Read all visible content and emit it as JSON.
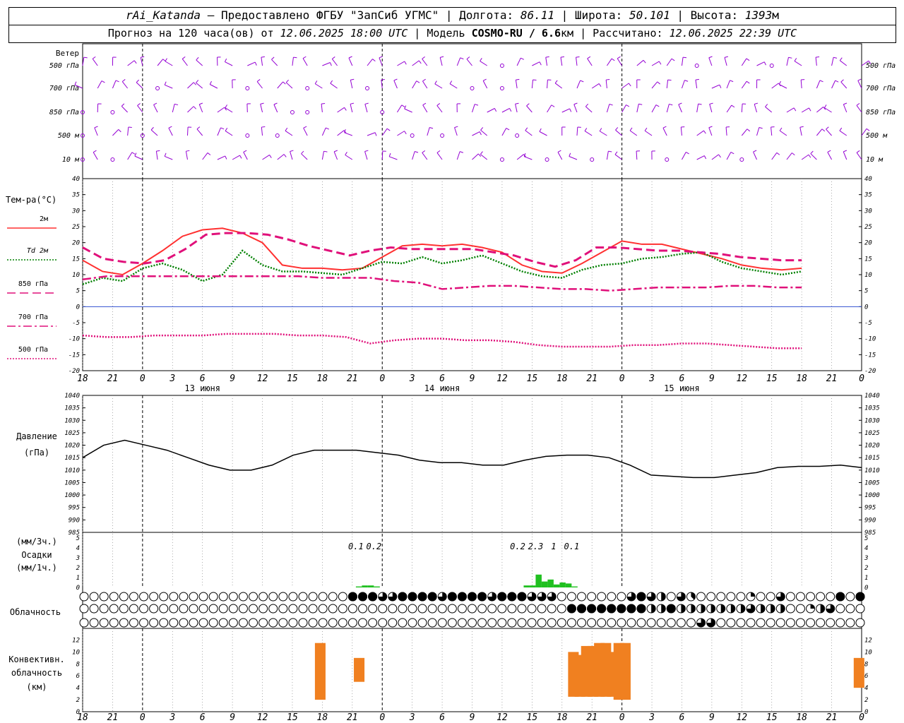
{
  "header": {
    "station": "rAi_Katanda",
    "sep1": " — ",
    "provider": "Предоставлено ФГБУ \"ЗапСиб УГМС\"",
    "lon_label": " | Долгота: ",
    "lon": "86.11",
    "lat_label": " | Широта: ",
    "lat": "50.101",
    "alt_label": " | Высота: ",
    "alt": "1393",
    "alt_unit": "м",
    "forecast_prefix": "Прогноз на 120 часа(ов) от ",
    "forecast_start": "12.06.2025 18:00 UTC",
    "model_label": "  | Модель ",
    "model": "COSMO-RU / 6.6",
    "model_unit": "км",
    "calc_label": " | Рассчитано: ",
    "calc_time": "12.06.2025 22:39 UTC"
  },
  "chart_data": {
    "type": "meteogram",
    "x_hours_ticks": [
      "18",
      "21",
      "0",
      "3",
      "6",
      "9",
      "12",
      "15",
      "18",
      "21",
      "0",
      "3",
      "6",
      "9",
      "12",
      "15",
      "18",
      "21",
      "0",
      "3",
      "6",
      "9",
      "12",
      "15",
      "18",
      "21",
      "0"
    ],
    "day_labels": [
      "13 июня",
      "14 июня",
      "15 июня"
    ],
    "wind": {
      "title": "Ветер",
      "levels": [
        "500 гПа",
        "700 гПа",
        "850 гПа",
        "500 м",
        "10 м"
      ],
      "color": "#9400d3"
    },
    "temperature": {
      "title": "Тем-ра(°C)",
      "ylim": [
        -20,
        40
      ],
      "yticks": [
        "40",
        "35",
        "30",
        "25",
        "20",
        "15",
        "10",
        "5",
        "0",
        "-5",
        "-10",
        "-15",
        "-20"
      ],
      "legend": [
        {
          "label": "2м",
          "color": "#ff3030",
          "style": "solid"
        },
        {
          "label": "Td  2м",
          "color": "#008000",
          "style": "dotted"
        },
        {
          "label": "850 гПа",
          "color": "#e0107a",
          "style": "dash"
        },
        {
          "label": "700 гПа",
          "color": "#e0107a",
          "style": "dashdot"
        },
        {
          "label": "500 гПа",
          "color": "#e0107a",
          "style": "dotted"
        }
      ],
      "series": [
        {
          "name": "2м",
          "x": [
            0,
            3,
            6,
            9,
            12,
            15,
            18,
            21,
            24,
            27,
            30,
            33,
            36,
            39,
            42,
            45,
            48,
            51,
            54,
            57,
            60,
            63,
            66,
            69,
            72,
            75,
            78,
            81,
            84,
            87,
            90,
            93,
            96,
            99,
            102,
            105,
            108,
            111,
            114,
            117,
            120
          ],
          "values": [
            14.5,
            11,
            10,
            13.5,
            17.5,
            22,
            24,
            24.5,
            23,
            20,
            13,
            12,
            12,
            11.5,
            12,
            15.5,
            19,
            19.5,
            19,
            19.5,
            18.5,
            17,
            13,
            11,
            10.5,
            13.5,
            17,
            20.5,
            19.5,
            19.5,
            18,
            16.5,
            15,
            13,
            12,
            11.5,
            12
          ]
        },
        {
          "name": "Td  2м",
          "x": [
            0,
            3,
            6,
            9,
            12,
            15,
            18,
            21,
            24,
            27,
            30,
            33,
            36,
            39,
            42,
            45,
            48,
            51,
            54,
            57,
            60,
            63,
            66,
            69,
            72,
            75,
            78,
            81,
            84,
            87,
            90,
            93,
            96,
            99,
            102,
            105,
            108,
            111,
            114,
            117,
            120
          ],
          "values": [
            7,
            9,
            8,
            12,
            13.5,
            11.5,
            8,
            10,
            17.5,
            13,
            11,
            11,
            10.5,
            10,
            12,
            14,
            13.5,
            15.5,
            13.5,
            14.5,
            16,
            13.5,
            11,
            9.5,
            9,
            11.5,
            13,
            13.5,
            15,
            15.5,
            16.5,
            17,
            14,
            12,
            11,
            10,
            11
          ]
        },
        {
          "name": "850 гПа",
          "x": [
            0,
            3,
            6,
            9,
            12,
            15,
            18,
            21,
            24,
            27,
            30,
            33,
            36,
            39,
            42,
            45,
            48,
            51,
            54,
            57,
            60,
            63,
            66,
            69,
            72,
            75,
            78,
            81,
            84,
            87,
            90,
            93,
            96,
            99,
            102,
            105,
            108,
            111,
            114,
            117,
            120
          ],
          "values": [
            18.5,
            15,
            14,
            13.5,
            14.5,
            18,
            22.5,
            23,
            23,
            22.5,
            21,
            19,
            17.5,
            16,
            17.5,
            18.5,
            18,
            18,
            18,
            18,
            17,
            16,
            14,
            12.5,
            14.5,
            18.5,
            18.5,
            18,
            17.5,
            17.5,
            17,
            16.5,
            15.5,
            15,
            14.5,
            14.5
          ]
        },
        {
          "name": "700 гПа",
          "x": [
            0,
            3,
            6,
            9,
            12,
            15,
            18,
            21,
            24,
            27,
            30,
            33,
            36,
            39,
            42,
            45,
            48,
            51,
            54,
            57,
            60,
            63,
            66,
            69,
            72,
            75,
            78,
            81,
            84,
            87,
            90,
            93,
            96,
            99,
            102,
            105,
            108,
            111,
            114,
            117,
            120
          ],
          "values": [
            8.5,
            9.5,
            9.5,
            9.5,
            9.5,
            9.5,
            9.5,
            9.5,
            9.5,
            9.5,
            9,
            9,
            9,
            8,
            7.5,
            5.5,
            6,
            6.5,
            6.5,
            6,
            5.5,
            5.5,
            5,
            5.5,
            6,
            6,
            6,
            6.5,
            6.5,
            6,
            6
          ]
        },
        {
          "name": "500 гПа",
          "x": [
            0,
            3,
            6,
            9,
            12,
            15,
            18,
            21,
            24,
            27,
            30,
            33,
            36,
            39,
            42,
            45,
            48,
            51,
            54,
            57,
            60,
            63,
            66,
            69,
            72,
            75,
            78,
            81,
            84,
            87,
            90,
            93,
            96,
            99,
            102,
            105,
            108,
            111,
            114,
            117,
            120
          ],
          "values": [
            -9,
            -9.5,
            -9.5,
            -9,
            -9,
            -9,
            -8.5,
            -8.5,
            -8.5,
            -9,
            -9,
            -9.5,
            -11.5,
            -10.5,
            -10,
            -10,
            -10.5,
            -10.5,
            -11,
            -12,
            -12.5,
            -12.5,
            -12.5,
            -12,
            -12,
            -11.5,
            -11.5,
            -12,
            -12.5,
            -13,
            -13
          ]
        }
      ]
    },
    "pressure": {
      "title": "Давление",
      "unit": "(гПа)",
      "ylim": [
        985,
        1040
      ],
      "yticks": [
        "1040",
        "1035",
        "1030",
        "1025",
        "1020",
        "1015",
        "1010",
        "1005",
        "1000",
        "995",
        "990",
        "985"
      ],
      "x": [
        0,
        3,
        6,
        9,
        12,
        15,
        18,
        21,
        24,
        27,
        30,
        33,
        36,
        39,
        42,
        45,
        48,
        51,
        54,
        57,
        60,
        63,
        66,
        69,
        72,
        75,
        78,
        81,
        84,
        87,
        90,
        93,
        96,
        99,
        102,
        105,
        108,
        111,
        114,
        117,
        120
      ],
      "values": [
        1015,
        1020,
        1022,
        1020,
        1018,
        1015,
        1012,
        1010,
        1010,
        1012,
        1016,
        1018,
        1018,
        1018,
        1017,
        1016,
        1014,
        1013,
        1013,
        1012,
        1012,
        1014,
        1015.5,
        1016,
        1016,
        1015,
        1012,
        1008,
        1007.5,
        1007,
        1007,
        1008,
        1009,
        1011,
        1011.5,
        1011.5,
        1012,
        1011
      ]
    },
    "precip": {
      "title": "Осадки",
      "unit_top": "(мм/3ч.)",
      "unit_bottom": "(мм/1ч.)",
      "ylim": [
        0,
        5
      ],
      "yticks": [
        "5",
        "4",
        "3",
        "2",
        "1",
        "0"
      ],
      "totals": [
        {
          "x": 45,
          "label": "0.1"
        },
        {
          "x": 48,
          "label": "0.2"
        },
        {
          "x": 72,
          "label": "0.2"
        },
        {
          "x": 75,
          "label": "2.3"
        },
        {
          "x": 78,
          "label": "1"
        },
        {
          "x": 81,
          "label": "0.1"
        }
      ],
      "hourly_x": [
        45,
        46,
        47,
        48,
        73,
        74,
        75,
        76,
        77,
        78,
        79,
        80,
        81
      ],
      "hourly_values": [
        0.1,
        0.2,
        0.2,
        0.1,
        0.2,
        0.2,
        1.3,
        0.6,
        0.8,
        0.3,
        0.5,
        0.4,
        0.1
      ]
    },
    "cloud": {
      "title": "Облачность",
      "rows": [
        "000000000000000000000000000888668888688886888666000000068640630000020060000080880008888000888686688888888",
        "000000000000000000000000000000000000000000000000088888888448444444464440024600000206000008888886688866888886",
        "000000000000000000000000000000000000000000000000000000000000006600000000000000000000000000000060400440000000"
      ]
    },
    "convective": {
      "title": "Конвективн.",
      "title2": "облачность",
      "unit": "(км)",
      "ylim": [
        0,
        13
      ],
      "yticks": [
        "12",
        "10",
        "8",
        "6",
        "4",
        "2",
        "0"
      ],
      "bars": [
        {
          "x": 36,
          "base": 2,
          "top": 11.5
        },
        {
          "x": 42,
          "base": 5,
          "top": 9
        },
        {
          "x": 75,
          "base": 2.5,
          "top": 10
        },
        {
          "x": 76,
          "base": 2.5,
          "top": 9.5
        },
        {
          "x": 77,
          "base": 2.5,
          "top": 11
        },
        {
          "x": 78,
          "base": 2.5,
          "top": 11
        },
        {
          "x": 79,
          "base": 2.5,
          "top": 11.5
        },
        {
          "x": 80,
          "base": 2.5,
          "top": 11.5
        },
        {
          "x": 81,
          "base": 2.5,
          "top": 10
        },
        {
          "x": 82,
          "base": 2,
          "top": 11.5
        },
        {
          "x": 83,
          "base": 2,
          "top": 11.5
        },
        {
          "x": 119,
          "base": 4,
          "top": 9
        }
      ],
      "color": "#f08020"
    }
  }
}
